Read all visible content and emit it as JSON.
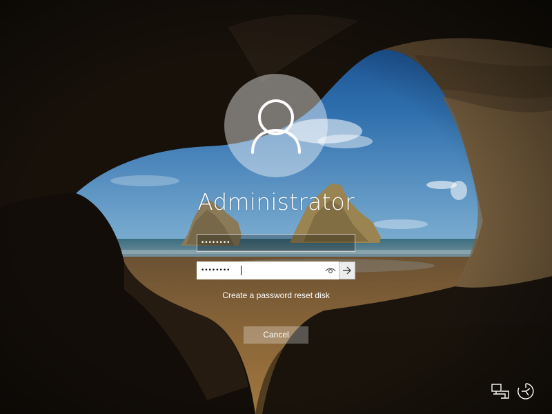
{
  "user": {
    "name": "Administrator",
    "avatar_icon": "user-silhouette-icon"
  },
  "password_fields": {
    "old_password_mask": "••••••••",
    "new_password_mask": "••••••••",
    "reveal_icon": "eye-icon",
    "submit_icon": "arrow-right-icon"
  },
  "links": {
    "reset_disk": "Create a password reset disk"
  },
  "buttons": {
    "cancel": "Cancel"
  },
  "system_icons": {
    "network": "network-icon",
    "ease_of_access": "ease-of-access-icon"
  },
  "colors": {
    "text": "#ffffff",
    "field_bg": "#ffffff",
    "button_bg": "rgba(255,255,255,0.28)"
  }
}
